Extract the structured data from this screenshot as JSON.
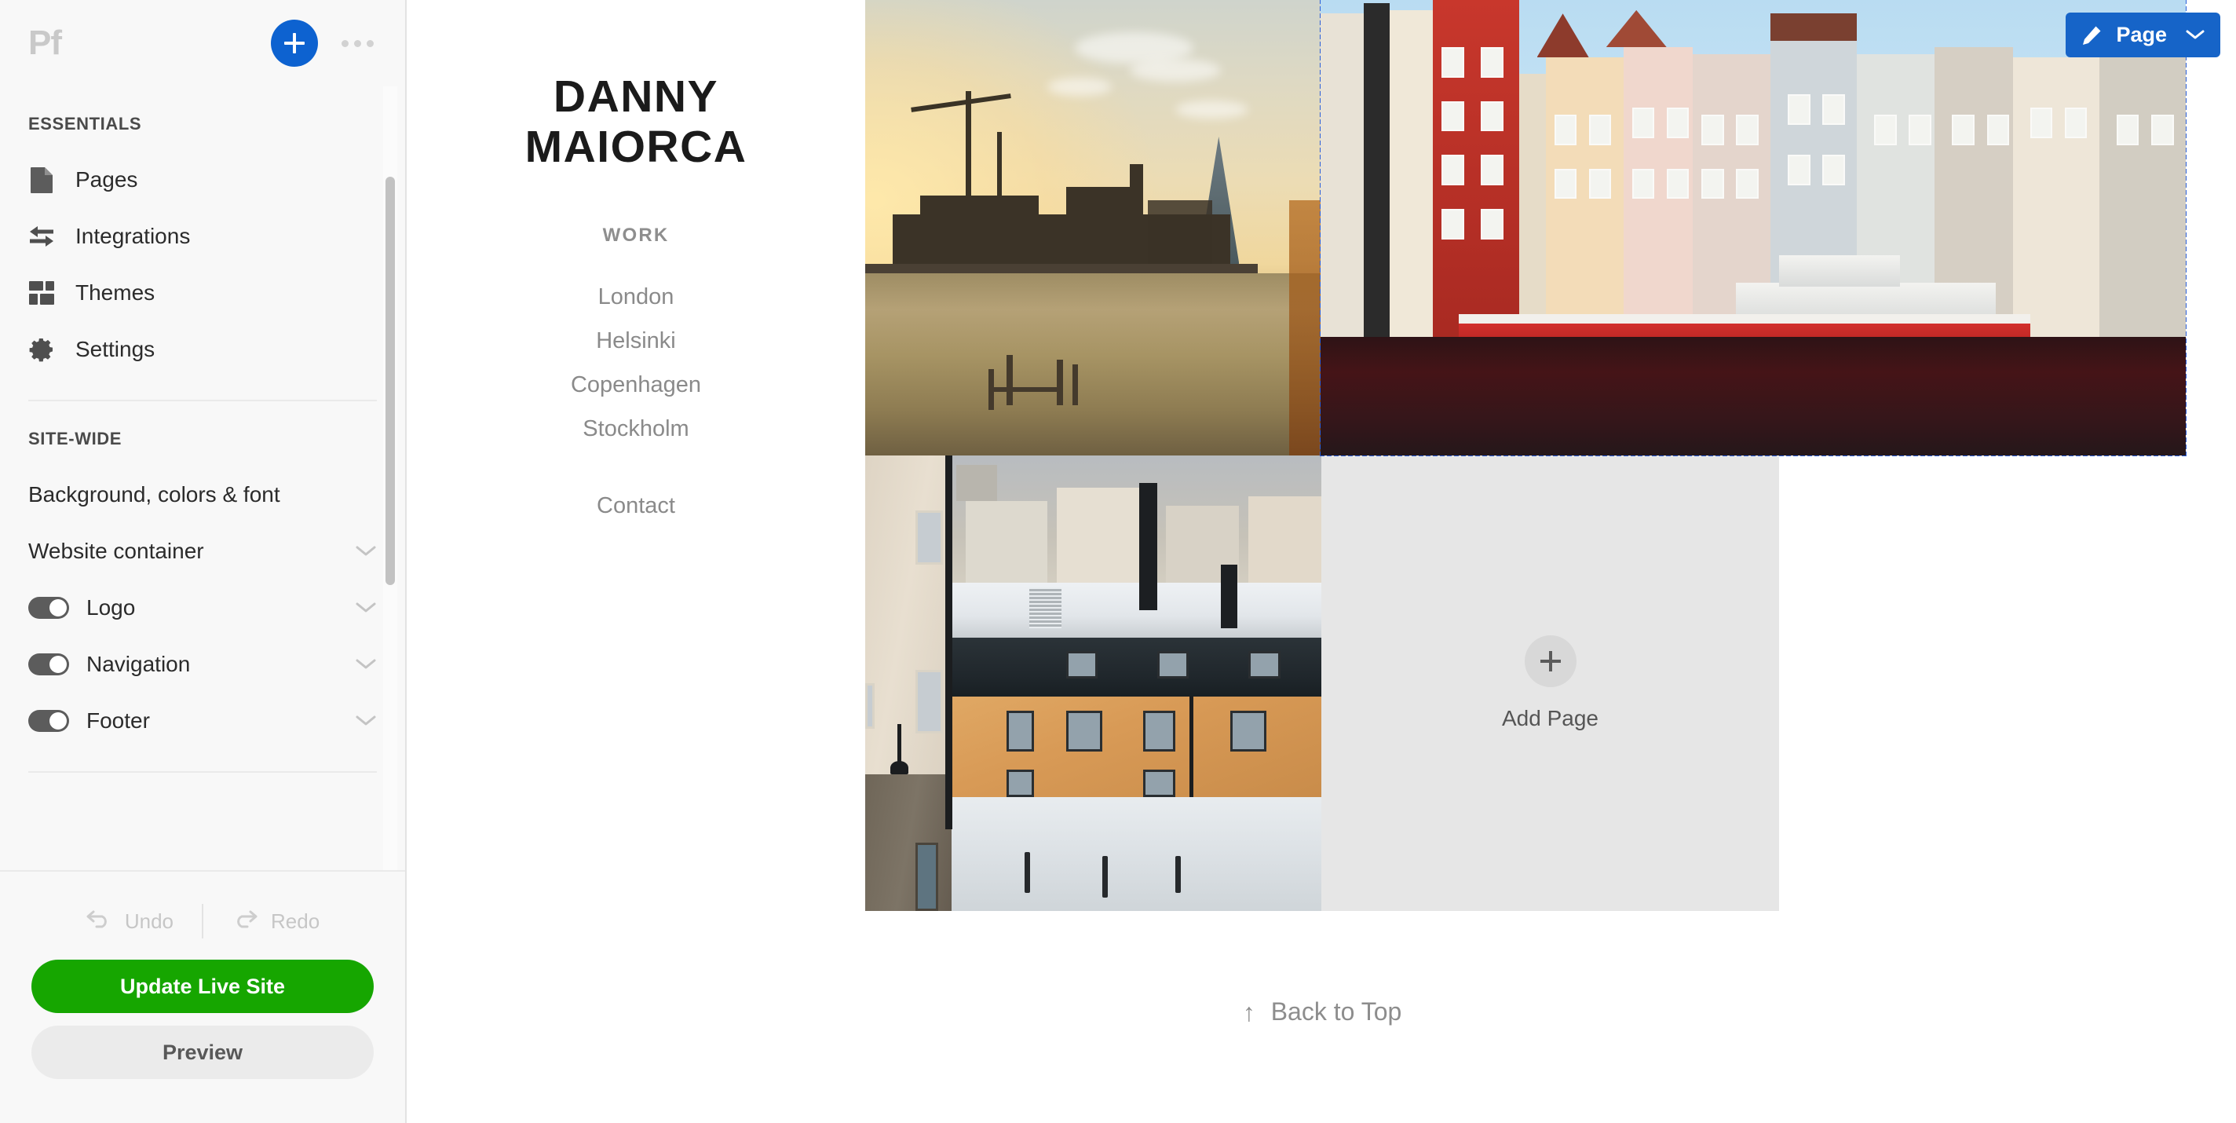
{
  "sidebar": {
    "logo": "Pf",
    "add_button_icon": "plus-icon",
    "more_button_icon": "ellipsis-icon",
    "essentials_label": "ESSENTIALS",
    "essentials_items": [
      {
        "label": "Pages",
        "icon": "page-icon"
      },
      {
        "label": "Integrations",
        "icon": "arrows-exchange-icon"
      },
      {
        "label": "Themes",
        "icon": "layout-blocks-icon"
      },
      {
        "label": "Settings",
        "icon": "gear-icon"
      }
    ],
    "sitewide_label": "SITE-WIDE",
    "sitewide_items": [
      {
        "label": "Background, colors & font",
        "toggle": false,
        "chevron": false
      },
      {
        "label": "Website container",
        "toggle": false,
        "chevron": true
      },
      {
        "label": "Logo",
        "toggle": true,
        "toggle_on": true,
        "chevron": true
      },
      {
        "label": "Navigation",
        "toggle": true,
        "toggle_on": true,
        "chevron": true
      },
      {
        "label": "Footer",
        "toggle": true,
        "toggle_on": true,
        "chevron": true
      }
    ],
    "undo_label": "Undo",
    "redo_label": "Redo",
    "publish_label": "Update Live Site",
    "preview_label": "Preview"
  },
  "toolbar": {
    "page_button_label": "Page",
    "page_button_icon": "pencil-icon",
    "page_button_chevron": "chevron-down-icon",
    "page_button_color": "#1664c8"
  },
  "site": {
    "title_line1": "DANNY",
    "title_line2": "MAIORCA",
    "nav_heading": "WORK",
    "nav_links": [
      "London",
      "Helsinki",
      "Copenhagen",
      "Stockholm"
    ],
    "contact_label": "Contact",
    "back_to_top_label": "Back to Top",
    "back_to_top_icon": "arrow-up-icon"
  },
  "grid": {
    "cells": [
      {
        "name": "London",
        "selected": false
      },
      {
        "name": "Helsinki",
        "selected": false
      },
      {
        "name": "Copenhagen",
        "selected": true
      },
      {
        "name": "Stockholm",
        "selected": false
      }
    ],
    "add_page_label": "Add Page",
    "add_page_icon": "plus-icon",
    "selection_color": "#2b5fd9"
  }
}
